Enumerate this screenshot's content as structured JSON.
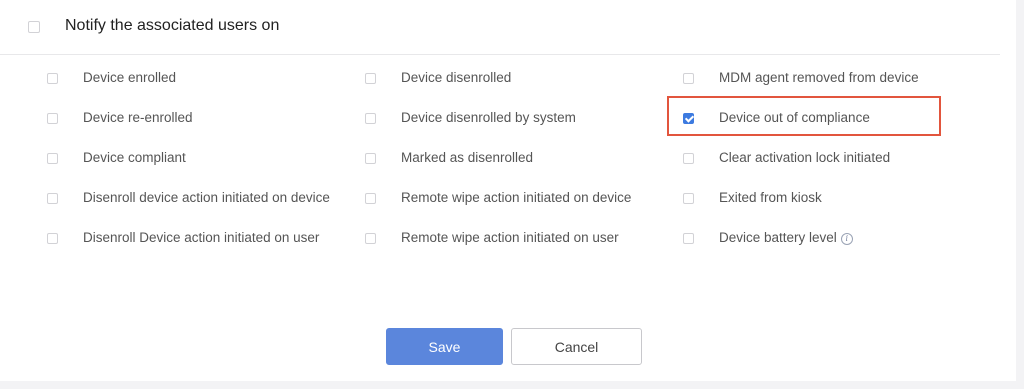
{
  "header": {
    "label": "Notify the associated users on",
    "checked": false
  },
  "options": {
    "col1": [
      {
        "label": "Device enrolled",
        "checked": false
      },
      {
        "label": "Device re-enrolled",
        "checked": false
      },
      {
        "label": "Device compliant",
        "checked": false
      },
      {
        "label": "Disenroll device action initiated on device",
        "checked": false
      },
      {
        "label": "Disenroll Device action initiated on user",
        "checked": false
      }
    ],
    "col2": [
      {
        "label": "Device disenrolled",
        "checked": false
      },
      {
        "label": "Device disenrolled by system",
        "checked": false
      },
      {
        "label": "Marked as disenrolled",
        "checked": false
      },
      {
        "label": "Remote wipe action initiated on device",
        "checked": false
      },
      {
        "label": "Remote wipe action initiated on user",
        "checked": false
      }
    ],
    "col3": [
      {
        "label": "MDM agent removed from device",
        "checked": false
      },
      {
        "label": "Device out of compliance",
        "checked": true
      },
      {
        "label": "Clear activation lock initiated",
        "checked": false
      },
      {
        "label": "Exited from kiosk",
        "checked": false
      },
      {
        "label": "Device battery level",
        "checked": false
      }
    ]
  },
  "buttons": {
    "save_label": "Save",
    "cancel_label": "Cancel"
  },
  "info_icon_glyph": "i",
  "colors": {
    "primary": "#5b86dc",
    "checked": "#3d7be0",
    "highlight": "#e2553d"
  }
}
